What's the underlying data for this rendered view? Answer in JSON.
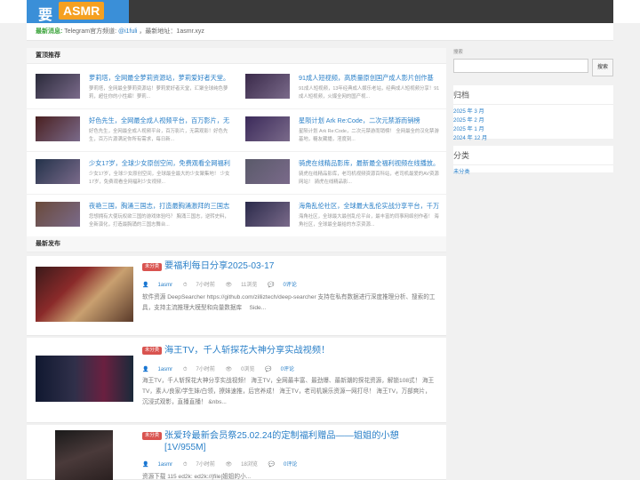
{
  "header": {
    "logo_cn": "要",
    "logo_en": "ASMR"
  },
  "notice": {
    "label": "最新消息:",
    "text_a": " Telegram官方频道: ",
    "link": "@i1fuli",
    "text_b": " ，最新地址：1asmr.xyz"
  },
  "featured": {
    "title": "置顶推荐",
    "items": [
      {
        "title": "萝莉塔，全网最全萝莉资源站，萝莉爱好者天堂。",
        "excerpt": "萝莉塔，全网最全萝莉资源站！萝莉爱好者天堂，汇聚全球纯色萝莉，超住你的小性癖！萝莉...",
        "thumb": "#2a2a3a"
      },
      {
        "title": "91成人短视频，高质量原创国产成人影片创作基",
        "excerpt": "91成人短视频，13年经典成人娱乐老站，经典成人短视频分享！91成人短视频，火爆全网的国产视...",
        "thumb": "#3a2a4a"
      },
      {
        "title": "好色先生，全网最全成人视频平台，百万影片，无",
        "excerpt": "好色先生，全网最全成人视频平台，百万影片，无需观影！好色先生，百万片源满足你所有需求，每日新...",
        "thumb": "#4a2020"
      },
      {
        "title": "星陨计划 Ark Re:Code，二次元禁游而销榜",
        "excerpt": "星陨计划 Ark Re:Code，二次元禁游而销榜！ 全网最全的汉化禁游基地，糖友藏播，淫度刻...",
        "thumb": "#3b2a5a"
      },
      {
        "title": "少女17岁，全球少女原创空间，免费观看全网福利",
        "excerpt": "少女17岁，全球少女原创空间，全球最全最大的少女聚集地！ 少女17岁，免费观看全网福利少女视频...",
        "thumb": "#23324a"
      },
      {
        "title": "骑虎在线精品影库，最新最全福利视频在线播放。",
        "excerpt": "骑虎在线精品影库，老司机视频资源百科站，老司机最爱的AV资源网站！ 骑虎在线精品影...",
        "thumb": "#5a5a6a"
      },
      {
        "title": "夜艳三国，胸涌三国志，打造最胸涌激拜的三国志",
        "excerpt": "您想拥有大使玩权欲三国的游戏体验吗？ 胸涌三国志，逆转史料，全新演化，打造最胸涌的三国志舞台...",
        "thumb": "#6a4a3a"
      },
      {
        "title": "海角乱伦社区，全球最大乱伦实战分享平台，千万",
        "excerpt": "海角社区，全球最大最创乱伦平台，最丰富的同事网络创作者！ 海角社区，全球最全最给的东京资源...",
        "thumb": "#2a2a4a"
      }
    ]
  },
  "latest": {
    "title": "最新发布",
    "posts": [
      {
        "badge": "未分类",
        "title": "要福利每日分享2025-03-17",
        "author": "1asmr",
        "time": "7小时前",
        "views": "11浏览",
        "comments": "0评论",
        "excerpt": "软件资源 DeepSearcher https://github.com/zilliztech/deep-searcher 支持在私有数据进行深度推理分析、搜索的工具，支持主流推理大模型和向量数据库 　Side..."
      },
      {
        "badge": "未分类",
        "title": "海王TV，千人斩探花大神分享实战视频！",
        "author": "1asmr",
        "time": "7小时前",
        "views": "0浏览",
        "comments": "0评论",
        "excerpt": "海王TV，千人斩探花大神分享实战视频！ 海王TV，全网最丰富、最劲爆、最新潮的探花资源，解锁108式！ 海王TV，素人/良家/学生妹/白领，撩妹速推，后宫养成！ 海王TV，老司机娱乐资源一网打尽！ 海王TV，万部爽片，沉浸式观影，直播直播！ &nbs..."
      },
      {
        "badge": "未分类",
        "title": "张爱玲最新会员祭25.02.24的定制福利赠品——姐姐的小憩[1V/955M]",
        "author": "1asmr",
        "time": "7小时前",
        "views": "18浏览",
        "comments": "0评论",
        "excerpt": "资源下载 115 ed2k: ed2k://|file|姐姐的小..."
      }
    ]
  },
  "sidebar": {
    "search_label": "搜索",
    "search_button": "搜索",
    "archive_title": "归档",
    "archives": [
      "2025 年 3 月",
      "2025 年 2 月",
      "2025 年 1 月",
      "2024 年 12 月"
    ],
    "category_title": "分类",
    "categories": [
      "未分类"
    ]
  }
}
